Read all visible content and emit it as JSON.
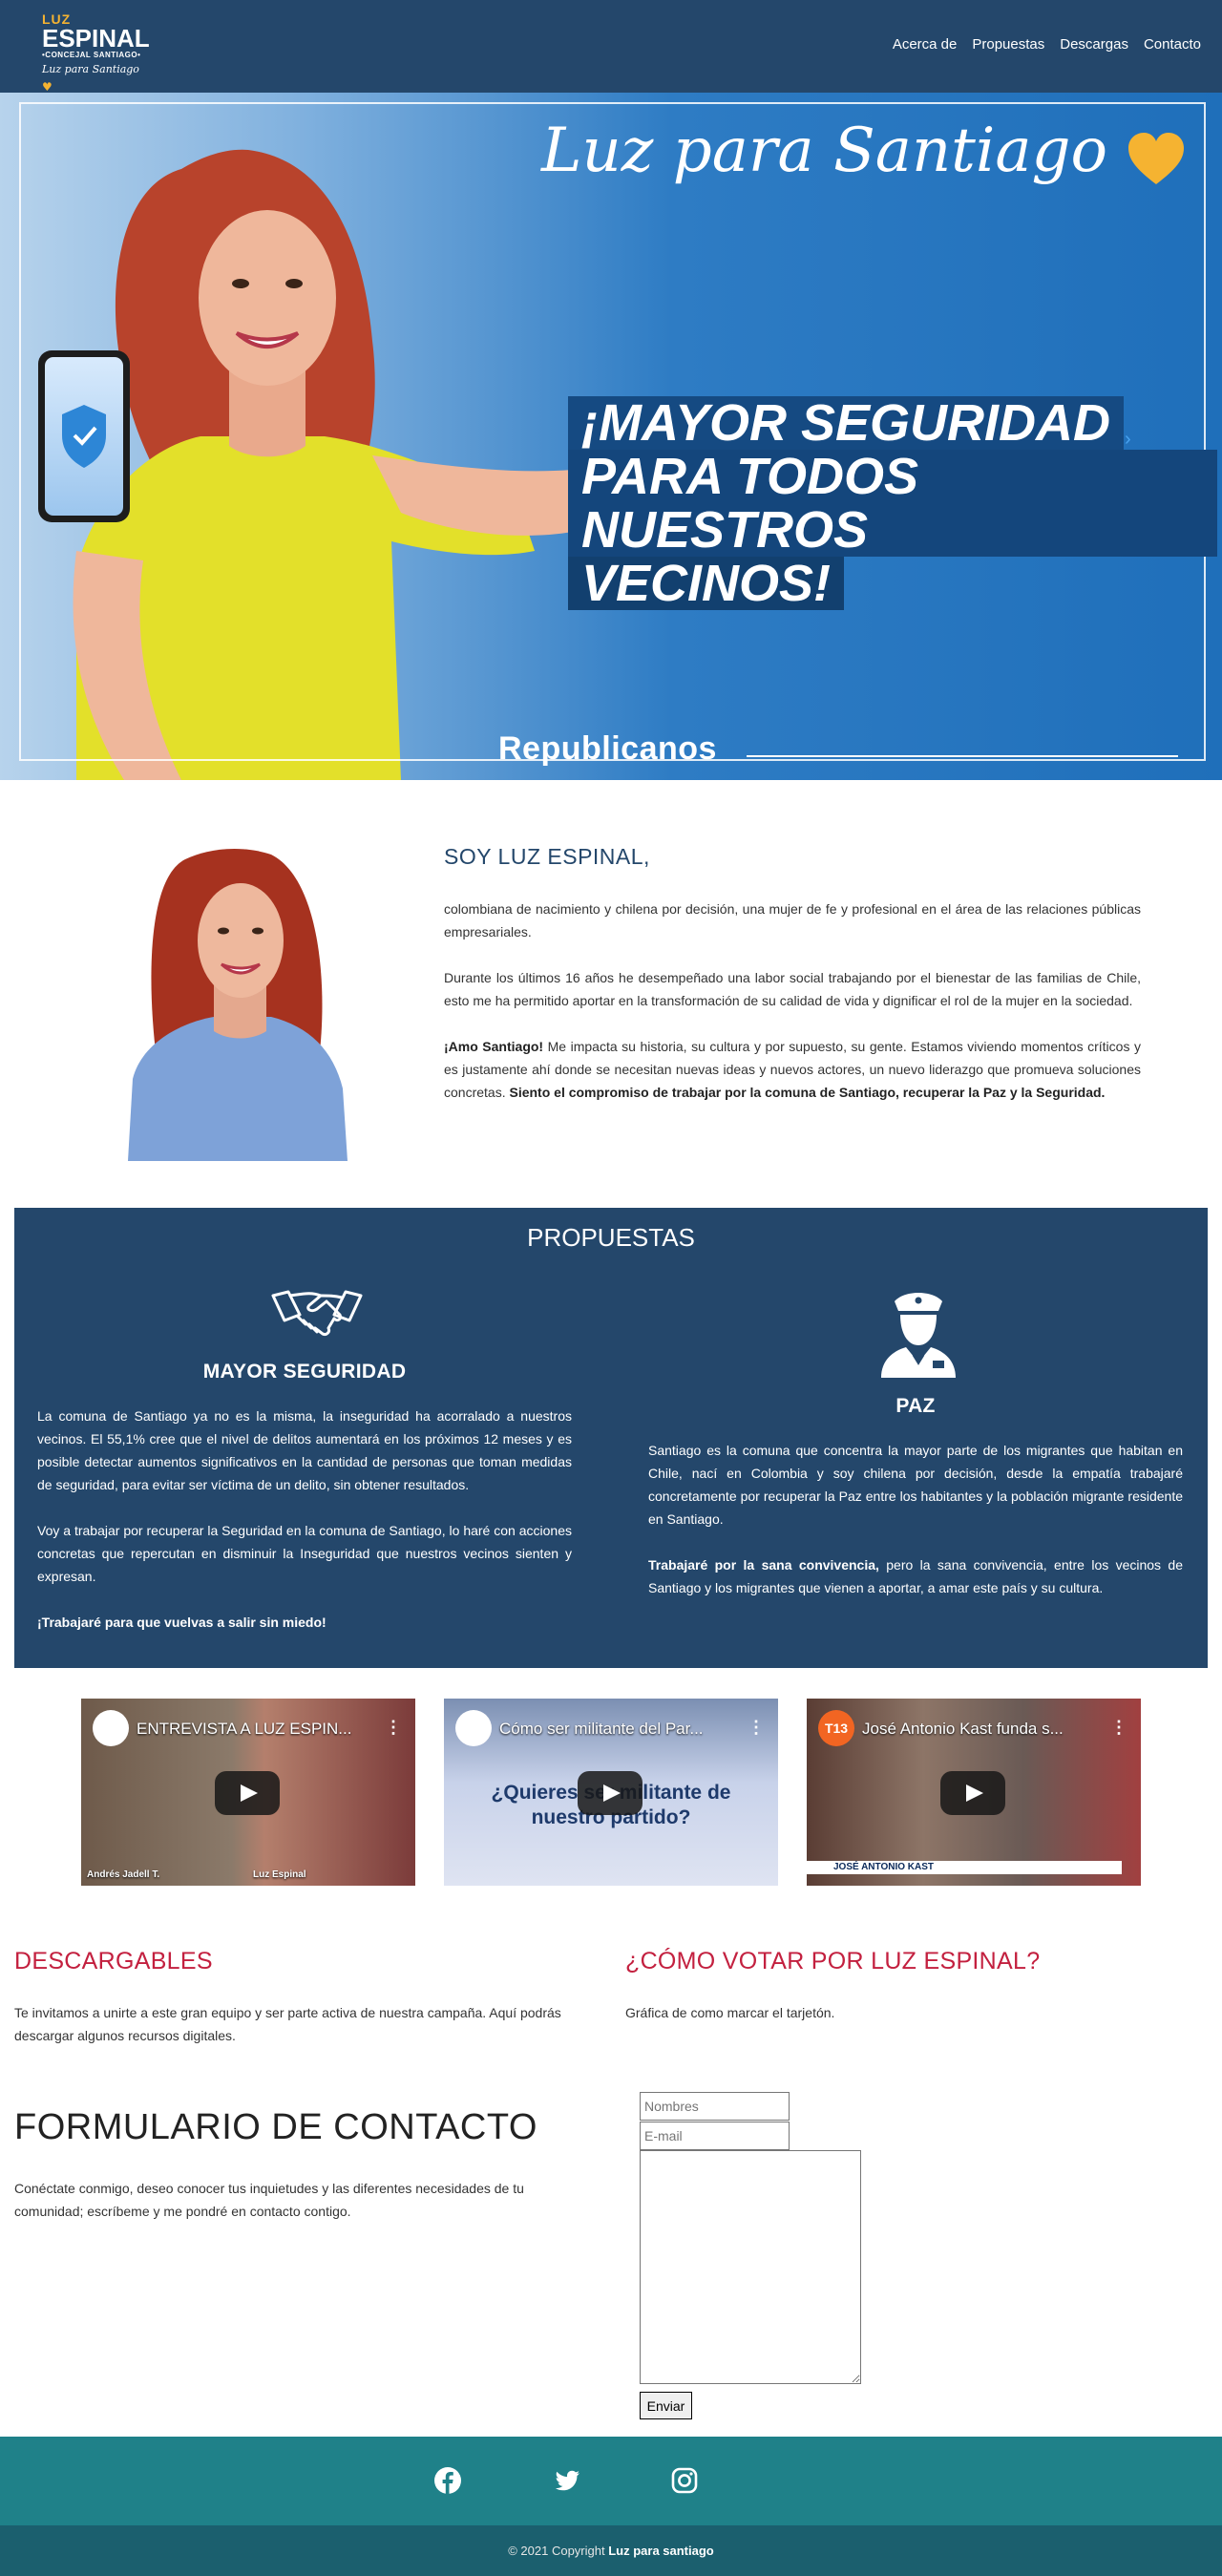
{
  "nav": {
    "logo": {
      "line1": "LUZ",
      "line2": "ESPINAL",
      "line3": "•CONCEJAL SANTIAGO•",
      "line4": "Luz para Santiago"
    },
    "menu": [
      "Acerca de",
      "Propuestas",
      "Descargas",
      "Contacto"
    ]
  },
  "hero": {
    "script": "Luz para Santiago",
    "headline": [
      "¡MAYOR SEGURIDAD",
      "PARA TODOS NUESTROS",
      "VECINOS!"
    ],
    "party": "Republicanos",
    "next_arrow": "›"
  },
  "about": {
    "title": "SOY LUZ ESPINAL,",
    "p1": "colombiana de nacimiento y chilena por decisión, una mujer de fe y profesional en el área de las relaciones públicas empresariales.",
    "p2": "Durante los últimos 16 años he desempeñado una labor social trabajando por el bienestar de las familias de Chile, esto me ha permitido aportar en la transformación de su calidad de vida y dignificar el rol de la mujer en la sociedad.",
    "p3_bold_start": "¡Amo Santiago!",
    "p3_mid": " Me impacta su historia, su cultura y por supuesto, su gente. Estamos viviendo momentos críticos y es justamente ahí donde se necesitan nuevas ideas y nuevos actores, un nuevo liderazgo que promueva soluciones concretas. ",
    "p3_bold_end": "Siento el compromiso de trabajar por la comuna de Santiago, recuperar la Paz y la Seguridad."
  },
  "proposals": {
    "title": "PROPUESTAS",
    "security": {
      "icon": "handshake-icon",
      "title": "MAYOR SEGURIDAD",
      "p1": "La comuna de Santiago ya no es la misma, la inseguridad ha acorralado a nuestros vecinos. El 55,1% cree que el nivel de delitos aumentará en los próximos 12 meses y es posible detectar aumentos significativos en la cantidad de personas que toman medidas de seguridad, para evitar ser víctima de un delito, sin obtener resultados.",
      "p2": "Voy a trabajar por recuperar la Seguridad en la comuna de Santiago, lo haré con acciones concretas que repercutan en disminuir la Inseguridad que nuestros vecinos sienten y expresan.",
      "p3": "¡Trabajaré para que vuelvas a salir sin miedo!"
    },
    "peace": {
      "icon": "police-officer-icon",
      "title": "PAZ",
      "p1": "Santiago es la comuna que concentra la mayor parte de los migrantes que habitan en Chile, nací en Colombia y soy chilena por decisión, desde la empatía trabajaré concretamente por recuperar la Paz entre los habitantes y la población migrante residente en Santiago.",
      "p2_bold": "Trabajaré por la sana convivencia,",
      "p2_rest": " pero la sana convivencia, entre los vecinos de Santiago y los migrantes que vienen a aportar, a amar este país y su cultura."
    }
  },
  "videos": [
    {
      "title": "ENTREVISTA A LUZ ESPIN...",
      "caption_left": "Andrés Jadell T.",
      "caption_right": "Luz Espinal"
    },
    {
      "title": "Cómo ser militante del Par...",
      "overlay": "¿Quieres ser militante de nuestro partido?"
    },
    {
      "title": "José Antonio Kast funda s...",
      "channel": "T13",
      "lower_third": "JOSÉ ANTONIO KAST"
    }
  ],
  "downloads": {
    "title": "DESCARGABLES",
    "text": "Te invitamos a unirte a este gran equipo y ser parte activa de nuestra campaña. Aquí podrás descargar algunos recursos digitales."
  },
  "vote": {
    "title": "¿CÓMO VOTAR POR LUZ ESPINAL?",
    "text": "Gráfica de como marcar el tarjetón."
  },
  "contact": {
    "title": "FORMULARIO DE CONTACTO",
    "text": "Conéctate conmigo, deseo conocer tus inquietudes y las diferentes necesidades de tu comunidad; escríbeme y me pondré en contacto contigo.",
    "name_placeholder": "Nombres",
    "email_placeholder": "E-mail",
    "submit": "Enviar"
  },
  "footer": {
    "social": [
      "facebook-icon",
      "twitter-icon",
      "instagram-icon"
    ],
    "copyright_prefix": "© 2021 Copyright ",
    "copyright_name": "Luz para santiago"
  },
  "colors": {
    "navy": "#24476b",
    "teal": "#1f8189",
    "teal_dark": "#1b5f6e",
    "red_heading": "#c3203f",
    "gold": "#f5b331"
  }
}
